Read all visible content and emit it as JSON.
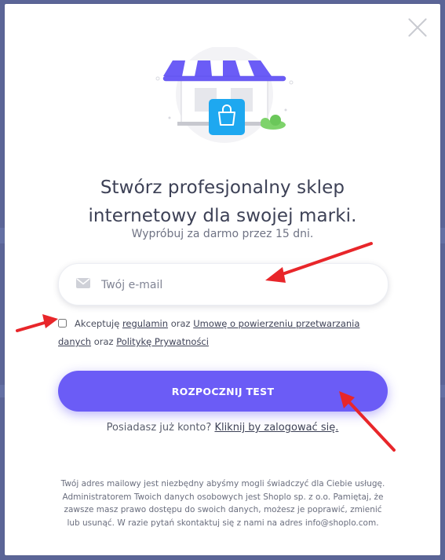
{
  "modal": {
    "title_line1": "Stwórz profesjonalny sklep",
    "title_line2": "internetowy dla swojej marki.",
    "subtitle": "Wypróbuj za darmo przez 15 dni."
  },
  "email": {
    "placeholder": "Twój e-mail",
    "value": ""
  },
  "consent": {
    "prefix": "Akceptuję",
    "link_terms": "regulamin",
    "and1": "oraz",
    "link_dpa_1": "Umowę o powierzeniu przetwarzania",
    "link_dpa_2": "danych",
    "and2": "oraz",
    "link_privacy": "Politykę Prywatności",
    "checked": false
  },
  "cta": {
    "label": "ROZPOCZNIJ TEST"
  },
  "login": {
    "prompt": "Posiadasz już konto?",
    "link": "Kliknij by zalogować się."
  },
  "privacy_note": "Twój adres mailowy jest niezbędny abyśmy mogli świadczyć dla Ciebie usługę. Administratorem Twoich danych osobowych jest Shoplo sp. z o.o. Pamiętaj, że zawsze masz prawo dostępu do swoich danych, możesz je poprawić, zmienić lub usunąć. W razie pytań skontaktuj się z nami na adres info@shoplo.com.",
  "colors": {
    "accent": "#6b5cf6",
    "backdrop": "#5b6597",
    "annotation_arrow": "#e8262a"
  },
  "icons": {
    "close": "close-icon",
    "email": "envelope-icon",
    "illustration": "shop-storefront-illustration",
    "bag": "shopping-bag-icon"
  }
}
